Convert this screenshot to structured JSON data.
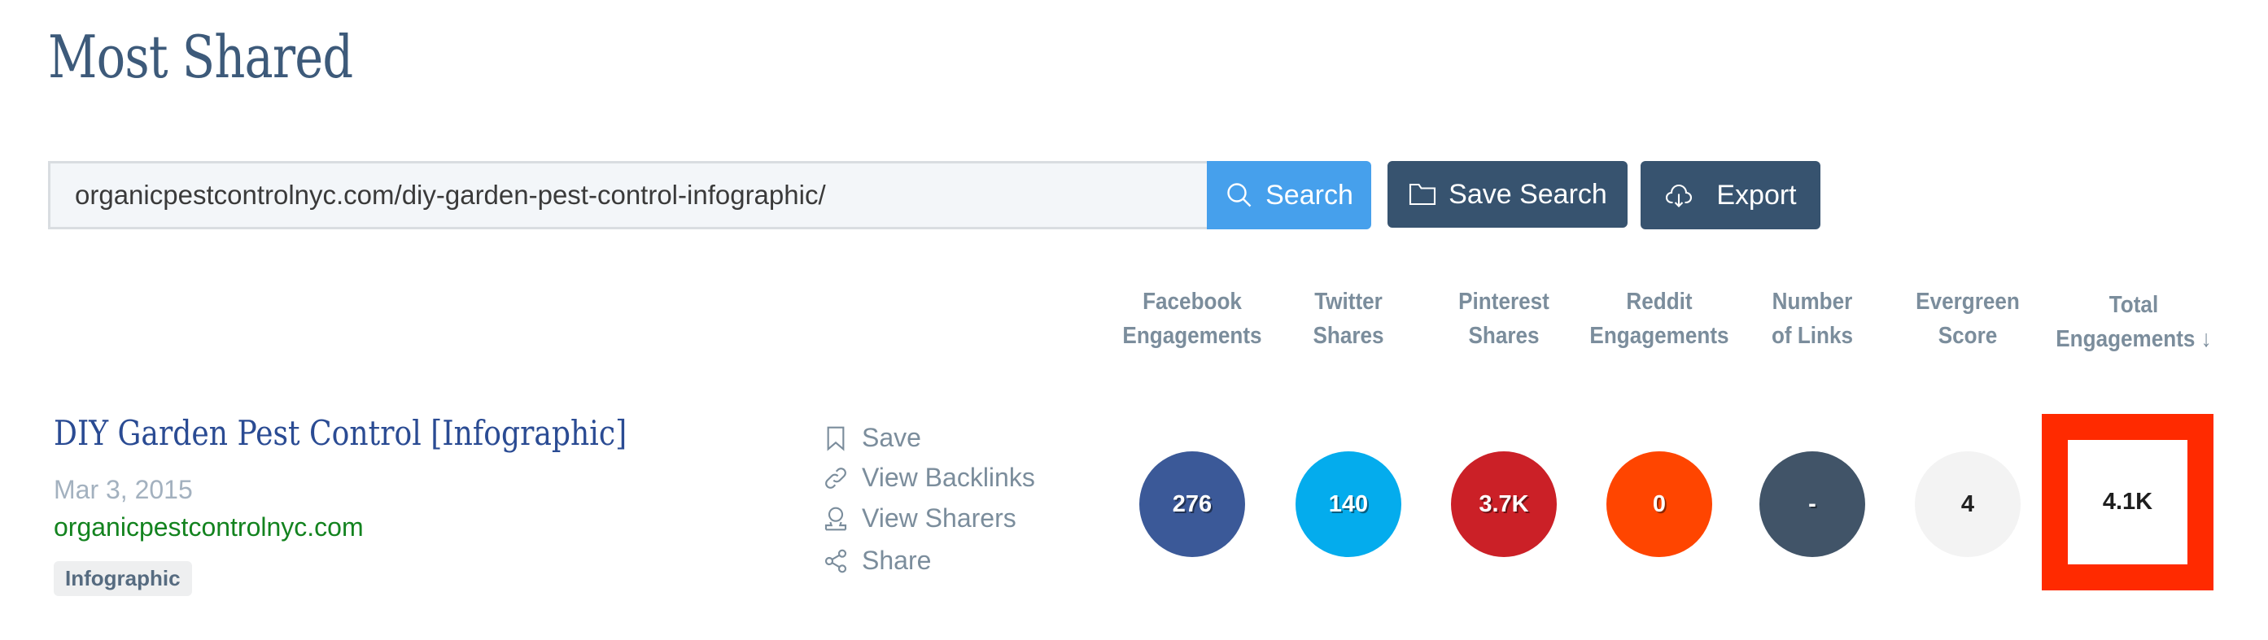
{
  "page": {
    "title": "Most Shared"
  },
  "search": {
    "value": "organicpestcontrolnyc.com/diy-garden-pest-control-infographic/",
    "search_label": "Search",
    "save_search_label": "Save Search",
    "export_label": "Export"
  },
  "columns": [
    {
      "line1": "Facebook",
      "line2": "Engagements"
    },
    {
      "line1": "Twitter",
      "line2": "Shares"
    },
    {
      "line1": "Pinterest",
      "line2": "Shares"
    },
    {
      "line1": "Reddit",
      "line2": "Engagements"
    },
    {
      "line1": "Number",
      "line2": "of Links"
    },
    {
      "line1": "Evergreen",
      "line2": "Score"
    },
    {
      "line1": "Total",
      "line2": "Engagements ↓"
    }
  ],
  "sort": {
    "column": "Total Engagements",
    "direction": "descending"
  },
  "result": {
    "title": "DIY Garden Pest Control [Infographic]",
    "date": "Mar 3, 2015",
    "domain": "organicpestcontrolnyc.com",
    "badge": "Infographic",
    "actions": [
      {
        "label": "Save",
        "icon": "bookmark-icon"
      },
      {
        "label": "View Backlinks",
        "icon": "link-icon"
      },
      {
        "label": "View Sharers",
        "icon": "user-icon"
      },
      {
        "label": "Share",
        "icon": "share-icon"
      }
    ],
    "metrics": {
      "facebook": "276",
      "twitter": "140",
      "pinterest": "3.7K",
      "reddit": "0",
      "links": "-",
      "evergreen": "4",
      "total": "4.1K"
    }
  },
  "colors": {
    "facebook": "#3b5998",
    "twitter": "#04aced",
    "pinterest": "#cb2027",
    "reddit": "#ff4500",
    "links": "#415468",
    "evergreen": "#f3f3f3",
    "highlight": "#ff2a00",
    "primary_button": "#46a0ec",
    "secondary_button": "#37536f"
  }
}
